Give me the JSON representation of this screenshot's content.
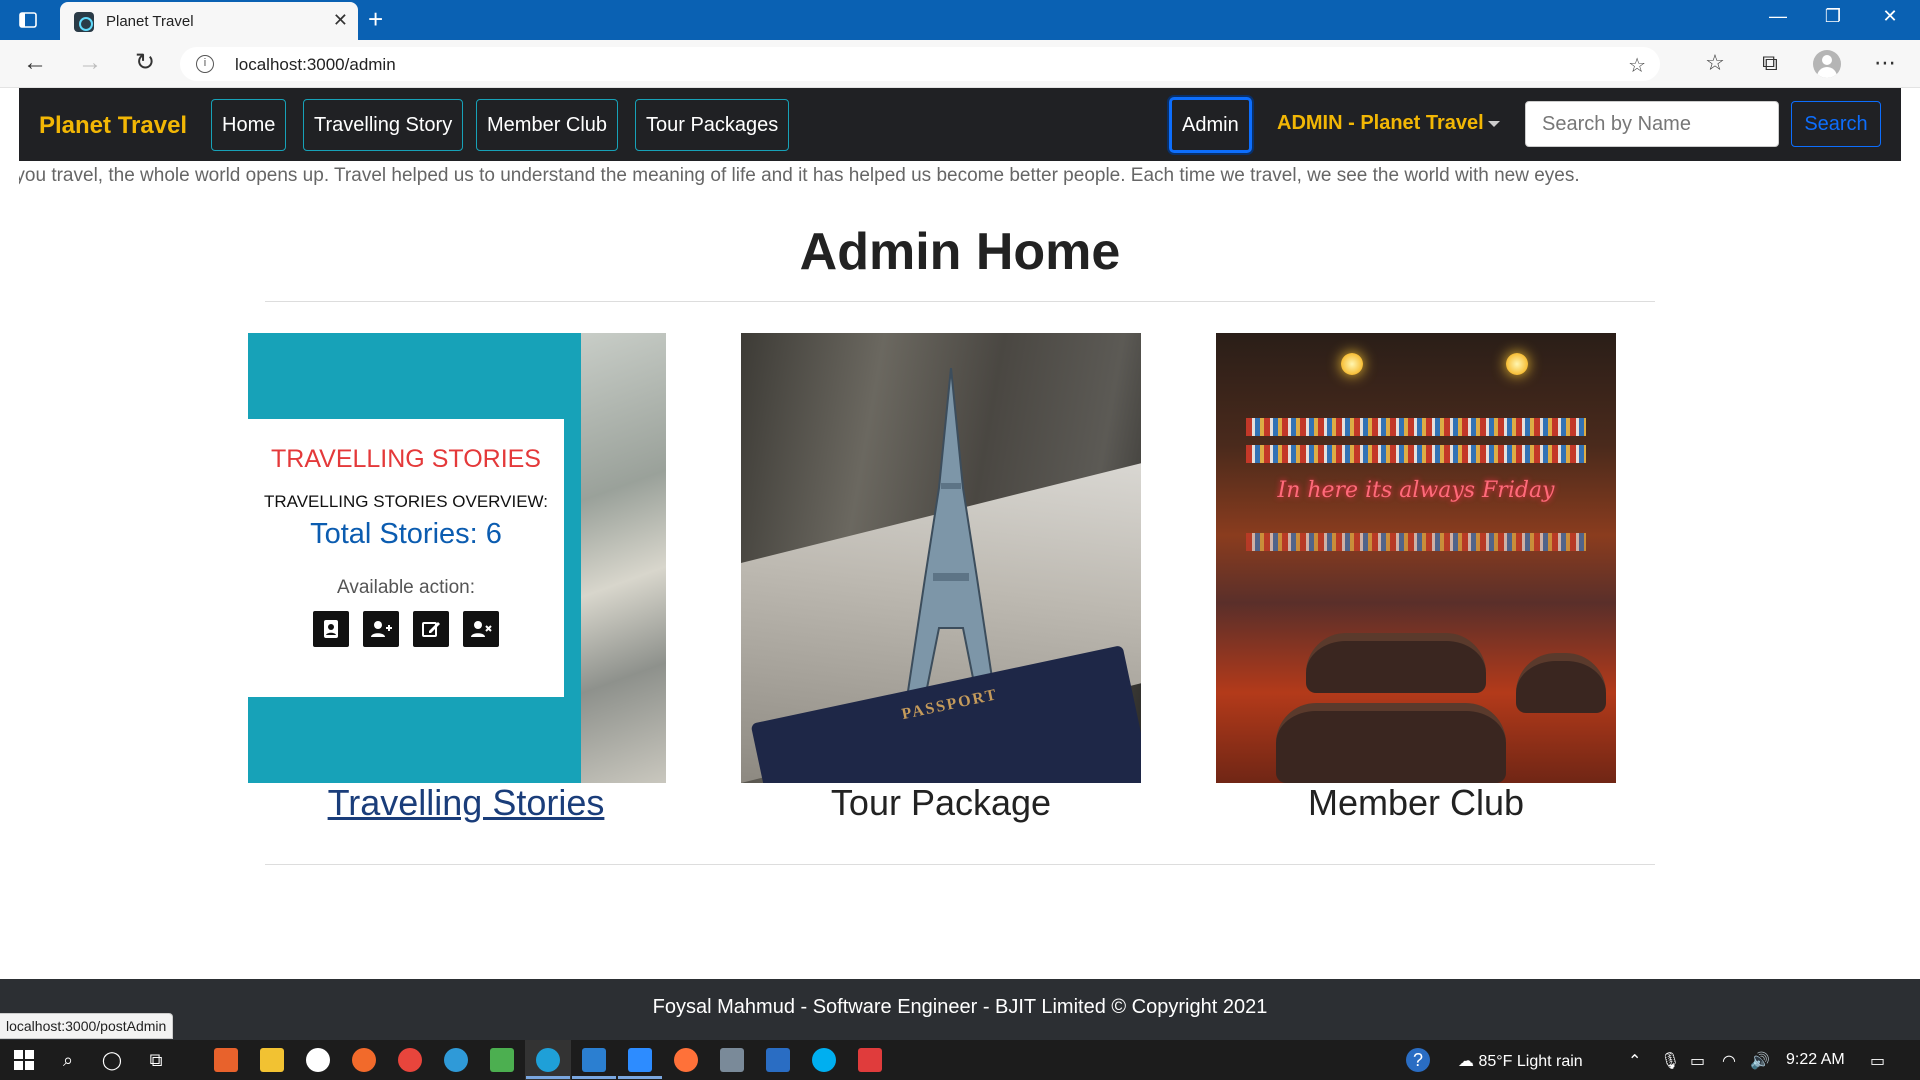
{
  "browser": {
    "tab_title": "Planet Travel",
    "url": "localhost:3000/admin",
    "status_url": "localhost:3000/postAdmin"
  },
  "navbar": {
    "brand": "Planet Travel",
    "links": [
      "Home",
      "Travelling Story",
      "Member Club",
      "Tour Packages"
    ],
    "admin_label": "Admin",
    "dropdown_label": "ADMIN - Planet Travel",
    "search_placeholder": "Search by Name",
    "search_button": "Search"
  },
  "marquee_text": "en you travel, the whole world opens up. Travel helped us to understand the meaning of life and it has helped us become better people. Each time we travel, we see the world with new eyes.",
  "page_title": "Admin Home",
  "cards": [
    {
      "overlay_title": "TRAVELLING STORIES",
      "overview_label": "TRAVELLING STORIES OVERVIEW:",
      "total_text": "Total Stories: 6",
      "action_label": "Available action:",
      "caption": "Travelling Stories"
    },
    {
      "caption": "Tour Package",
      "passport_text": "PASSPORT"
    },
    {
      "caption": "Member Club",
      "neon_text": "In here its always Friday"
    }
  ],
  "footer_text": "Foysal Mahmud - Software Engineer - BJIT Limited © Copyright 2021",
  "taskbar": {
    "weather": "85°F  Light rain",
    "time": "9:22 AM"
  },
  "colors": {
    "brand_yellow": "#f2b705",
    "teal": "#17a2b8",
    "primary_blue": "#0d6efd",
    "nav_bg": "#202124",
    "footer_bg": "#2c2f33"
  }
}
